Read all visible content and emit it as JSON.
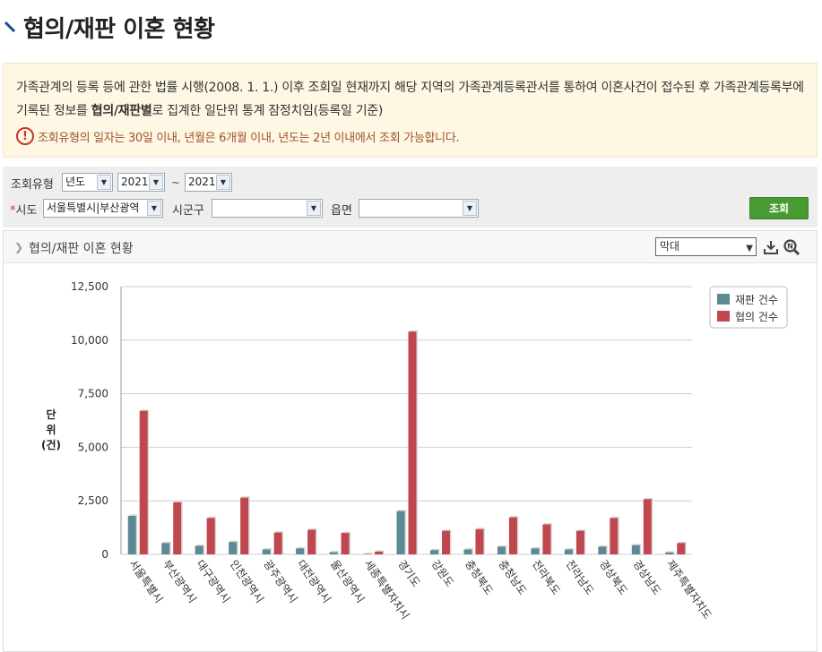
{
  "page": {
    "title": "협의/재판 이혼 현황"
  },
  "notice": {
    "text_pre": "가족관계의 등록 등에 관한 법률 시행(2008. 1. 1.) 이후 조회일 현재까지 해당 지역의 가족관계등록관서를 통하여 이혼사건이 접수된 후 가족관계등록부에 기록된 정보를 ",
    "text_bold": "협의/재판별",
    "text_post": "로 집계한 일단위 통계 잠정치임(등록일 기준)",
    "warning": "조회유형의 일자는 30일 이내, 년월은 6개월 이내, 년도는 2년 이내에서 조회 가능합니다."
  },
  "filters": {
    "type_label": "조회유형",
    "type_value": "년도",
    "from_value": "2021",
    "tilde": "~",
    "to_value": "2021",
    "sido_required": "*",
    "sido_label": "시도",
    "sido_value": "서울특별시|부산광역",
    "sigungu_label": "시군구",
    "sigungu_value": "",
    "eupmyeon_label": "읍면",
    "eupmyeon_value": "",
    "search_label": "조회"
  },
  "chart_panel": {
    "title": "협의/재판 이혼 현황",
    "chart_type": "막대",
    "icons": [
      "download-icon",
      "zoom-icon"
    ]
  },
  "chart_data": {
    "type": "bar",
    "title": "",
    "ylabel": "단위(건)",
    "ylim": [
      0,
      12500
    ],
    "yticks": [
      0,
      2500,
      5000,
      7500,
      10000,
      12500
    ],
    "ytick_labels": [
      "0",
      "2,500",
      "5,000",
      "7,500",
      "10,000",
      "12,500"
    ],
    "grid": true,
    "legend_position": "top-right",
    "categories": [
      "서울특별시",
      "부산광역시",
      "대구광역시",
      "인천광역시",
      "광주광역시",
      "대전광역시",
      "울산광역시",
      "세종특별자치시",
      "경기도",
      "강원도",
      "충청북도",
      "충청남도",
      "전라북도",
      "전라남도",
      "경상북도",
      "경상남도",
      "제주특별자치도"
    ],
    "series": [
      {
        "name": "재판 건수",
        "color": "#5b8a94",
        "values": [
          1800,
          530,
          400,
          580,
          230,
          280,
          100,
          20,
          2020,
          200,
          230,
          360,
          280,
          230,
          360,
          430,
          90
        ]
      },
      {
        "name": "협의 건수",
        "color": "#c0474e",
        "values": [
          6700,
          2430,
          1700,
          2650,
          1020,
          1150,
          1000,
          130,
          10400,
          1100,
          1180,
          1730,
          1400,
          1100,
          1700,
          2580,
          530
        ]
      }
    ]
  }
}
